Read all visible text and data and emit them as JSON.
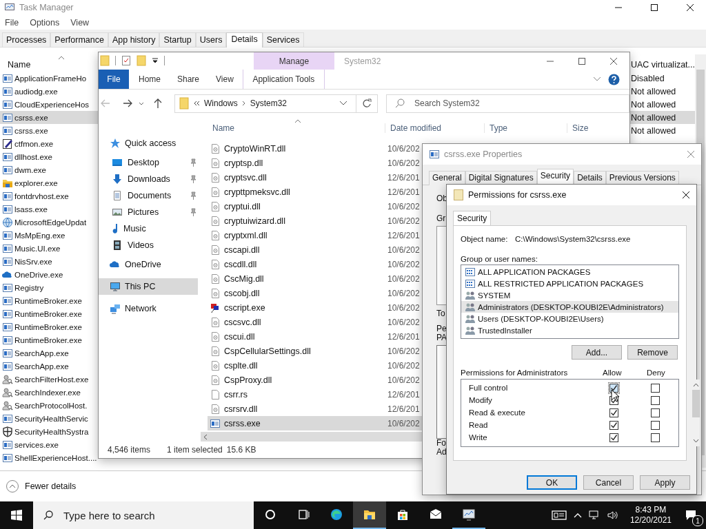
{
  "task_manager": {
    "title": "Task Manager",
    "menu": [
      "File",
      "Options",
      "View"
    ],
    "tabs": [
      {
        "label": "Processes",
        "selected": false
      },
      {
        "label": "Performance",
        "selected": false
      },
      {
        "label": "App history",
        "selected": false
      },
      {
        "label": "Startup",
        "selected": false
      },
      {
        "label": "Users",
        "selected": false
      },
      {
        "label": "Details",
        "selected": true
      },
      {
        "label": "Services",
        "selected": false
      }
    ],
    "columns": {
      "name": "Name",
      "uac": "UAC virtualizat..."
    },
    "rows": [
      {
        "kind": "app",
        "name": "ApplicationFrameHo",
        "uac": "Disabled",
        "selected": false
      },
      {
        "kind": "app",
        "name": "audiodg.exe",
        "uac": "Not allowed",
        "selected": false
      },
      {
        "kind": "app",
        "name": "CloudExperienceHos",
        "uac": "Not allowed",
        "selected": false
      },
      {
        "kind": "app",
        "name": "csrss.exe",
        "uac": "Not allowed",
        "selected": true
      },
      {
        "kind": "app",
        "name": "csrss.exe",
        "uac": "Not allowed",
        "selected": false
      },
      {
        "kind": "pen",
        "name": "ctfmon.exe",
        "selected": false
      },
      {
        "kind": "app",
        "name": "dllhost.exe",
        "selected": false
      },
      {
        "kind": "app",
        "name": "dwm.exe",
        "selected": false
      },
      {
        "kind": "folder",
        "name": "explorer.exe",
        "selected": false
      },
      {
        "kind": "app",
        "name": "fontdrvhost.exe",
        "selected": false
      },
      {
        "kind": "app",
        "name": "lsass.exe",
        "selected": false
      },
      {
        "kind": "globe",
        "name": "MicrosoftEdgeUpdat",
        "selected": false
      },
      {
        "kind": "app",
        "name": "MsMpEng.exe",
        "selected": false
      },
      {
        "kind": "app",
        "name": "Music.UI.exe",
        "selected": false
      },
      {
        "kind": "app",
        "name": "NisSrv.exe",
        "selected": false
      },
      {
        "kind": "cloud",
        "name": "OneDrive.exe",
        "selected": false
      },
      {
        "kind": "app",
        "name": "Registry",
        "selected": false
      },
      {
        "kind": "app",
        "name": "RuntimeBroker.exe",
        "selected": false
      },
      {
        "kind": "app",
        "name": "RuntimeBroker.exe",
        "selected": false
      },
      {
        "kind": "app",
        "name": "RuntimeBroker.exe",
        "selected": false
      },
      {
        "kind": "app",
        "name": "RuntimeBroker.exe",
        "selected": false
      },
      {
        "kind": "app",
        "name": "SearchApp.exe",
        "selected": false
      },
      {
        "kind": "app",
        "name": "SearchApp.exe",
        "selected": false
      },
      {
        "kind": "person",
        "name": "SearchFilterHost.exe",
        "selected": false
      },
      {
        "kind": "person",
        "name": "SearchIndexer.exe",
        "selected": false
      },
      {
        "kind": "person",
        "name": "SearchProtocolHost.",
        "selected": false
      },
      {
        "kind": "app",
        "name": "SecurityHealthServic",
        "selected": false
      },
      {
        "kind": "shield",
        "name": "SecurityHealthSystra",
        "selected": false
      },
      {
        "kind": "app",
        "name": "services.exe",
        "selected": false
      },
      {
        "kind": "app",
        "name": "ShellExperienceHost....",
        "selected": false
      }
    ],
    "fewer_details": "Fewer details"
  },
  "explorer": {
    "title": "System32",
    "context_tab": "Manage",
    "ribbon_tabs": [
      {
        "label": "File",
        "kind": "file"
      },
      {
        "label": "Home",
        "kind": "tab"
      },
      {
        "label": "Share",
        "kind": "tab"
      },
      {
        "label": "View",
        "kind": "tab"
      },
      {
        "label": "Application Tools",
        "kind": "context"
      }
    ],
    "address": [
      "Windows",
      "System32"
    ],
    "search": {
      "placeholder": "Search System32"
    },
    "nav": [
      {
        "label": "Quick access",
        "kind": "star",
        "selected": false,
        "children": [
          {
            "label": "Desktop",
            "kind": "desktop",
            "pinned": true,
            "selected": false
          },
          {
            "label": "Downloads",
            "kind": "download",
            "pinned": true,
            "selected": false
          },
          {
            "label": "Documents",
            "kind": "document",
            "pinned": true,
            "selected": false
          },
          {
            "label": "Pictures",
            "kind": "picture",
            "pinned": true,
            "selected": false
          },
          {
            "label": "Music",
            "kind": "music",
            "pinned": false,
            "selected": false
          },
          {
            "label": "Videos",
            "kind": "film",
            "pinned": false,
            "selected": false
          }
        ]
      },
      {
        "label": "OneDrive",
        "kind": "cloud",
        "selected": false
      },
      {
        "label": "This PC",
        "kind": "monitor",
        "selected": true
      },
      {
        "label": "Network",
        "kind": "network",
        "selected": false
      }
    ],
    "columns": [
      "Name",
      "Date modified",
      "Type",
      "Size"
    ],
    "files": [
      {
        "name": "CryptoWinRT.dll",
        "kind": "dll",
        "date": "10/6/202",
        "selected": false
      },
      {
        "name": "cryptsp.dll",
        "kind": "dll",
        "date": "10/6/202",
        "selected": false
      },
      {
        "name": "cryptsvc.dll",
        "kind": "dll",
        "date": "12/6/201",
        "selected": false
      },
      {
        "name": "crypttpmeksvc.dll",
        "kind": "dll",
        "date": "12/6/201",
        "selected": false
      },
      {
        "name": "cryptui.dll",
        "kind": "dll",
        "date": "10/6/202",
        "selected": false
      },
      {
        "name": "cryptuiwizard.dll",
        "kind": "dll",
        "date": "10/6/202",
        "selected": false
      },
      {
        "name": "cryptxml.dll",
        "kind": "dll",
        "date": "12/6/201",
        "selected": false
      },
      {
        "name": "cscapi.dll",
        "kind": "dll",
        "date": "10/6/202",
        "selected": false
      },
      {
        "name": "cscdll.dll",
        "kind": "dll",
        "date": "10/6/202",
        "selected": false
      },
      {
        "name": "CscMig.dll",
        "kind": "dll",
        "date": "10/6/202",
        "selected": false
      },
      {
        "name": "cscobj.dll",
        "kind": "dll",
        "date": "10/6/202",
        "selected": false
      },
      {
        "name": "cscript.exe",
        "kind": "script",
        "date": "10/6/202",
        "selected": false
      },
      {
        "name": "cscsvc.dll",
        "kind": "dll",
        "date": "10/6/202",
        "selected": false
      },
      {
        "name": "cscui.dll",
        "kind": "dll",
        "date": "12/6/201",
        "selected": false
      },
      {
        "name": "CspCellularSettings.dll",
        "kind": "dll",
        "date": "10/6/202",
        "selected": false
      },
      {
        "name": "csplte.dll",
        "kind": "dll",
        "date": "10/6/202",
        "selected": false
      },
      {
        "name": "CspProxy.dll",
        "kind": "dll",
        "date": "10/6/202",
        "selected": false
      },
      {
        "name": "csrr.rs",
        "kind": "file",
        "date": "12/6/201",
        "selected": false
      },
      {
        "name": "csrsrv.dll",
        "kind": "dll",
        "date": "12/6/201",
        "selected": false
      },
      {
        "name": "csrss.exe",
        "kind": "exe",
        "date": "10/6/202",
        "selected": true
      }
    ],
    "status": {
      "count": "4,546 items",
      "selection": "1 item selected",
      "size": "15.6 KB"
    }
  },
  "properties": {
    "title": "csrss.exe Properties",
    "tabs": [
      {
        "label": "General",
        "selected": false
      },
      {
        "label": "Digital Signatures",
        "selected": false
      },
      {
        "label": "Security",
        "selected": true
      },
      {
        "label": "Details",
        "selected": false
      },
      {
        "label": "Previous Versions",
        "selected": false
      }
    ],
    "fragments": [
      "Ob",
      "Gr",
      "To",
      "Pe",
      "PA",
      "Fo",
      "Ad"
    ]
  },
  "permissions": {
    "title": "Permissions for csrss.exe",
    "tab": "Security",
    "object_label": "Object name:",
    "object_value": "C:\\Windows\\System32\\csrss.exe",
    "groups_label": "Group or user names:",
    "groups": [
      {
        "name": "ALL APPLICATION PACKAGES",
        "kind": "package",
        "selected": false
      },
      {
        "name": "ALL RESTRICTED APPLICATION PACKAGES",
        "kind": "package",
        "selected": false
      },
      {
        "name": "SYSTEM",
        "kind": "group",
        "selected": false
      },
      {
        "name": "Administrators (DESKTOP-KOUBI2E\\Administrators)",
        "kind": "group",
        "selected": true
      },
      {
        "name": "Users (DESKTOP-KOUBI2E\\Users)",
        "kind": "group",
        "selected": false
      },
      {
        "name": "TrustedInstaller",
        "kind": "group",
        "selected": false
      }
    ],
    "group_buttons": [
      "Add...",
      "Remove"
    ],
    "perm_label": "Permissions for Administrators",
    "allow_label": "Allow",
    "deny_label": "Deny",
    "perms": [
      {
        "name": "Full control",
        "allow": true,
        "deny": false
      },
      {
        "name": "Modify",
        "allow": true,
        "deny": false
      },
      {
        "name": "Read & execute",
        "allow": true,
        "deny": false
      },
      {
        "name": "Read",
        "allow": true,
        "deny": false
      },
      {
        "name": "Write",
        "allow": true,
        "deny": false
      }
    ],
    "buttons": [
      {
        "label": "OK",
        "default": true
      },
      {
        "label": "Cancel",
        "default": false
      },
      {
        "label": "Apply",
        "default": false
      }
    ]
  },
  "taskbar": {
    "search": {
      "placeholder": "Type here to search"
    },
    "apps": [
      {
        "kind": "cortana",
        "running": false,
        "selected": false
      },
      {
        "kind": "taskview",
        "running": false,
        "selected": false
      },
      {
        "kind": "browser",
        "running": false,
        "selected": false
      },
      {
        "kind": "explorer",
        "running": true,
        "selected": true
      },
      {
        "kind": "store",
        "running": false,
        "selected": false
      },
      {
        "kind": "mail",
        "running": false,
        "selected": false
      },
      {
        "kind": "taskmgr",
        "running": true,
        "selected": false
      }
    ],
    "time": "8:43 PM",
    "date": "12/20/2021",
    "notifications": "1"
  }
}
